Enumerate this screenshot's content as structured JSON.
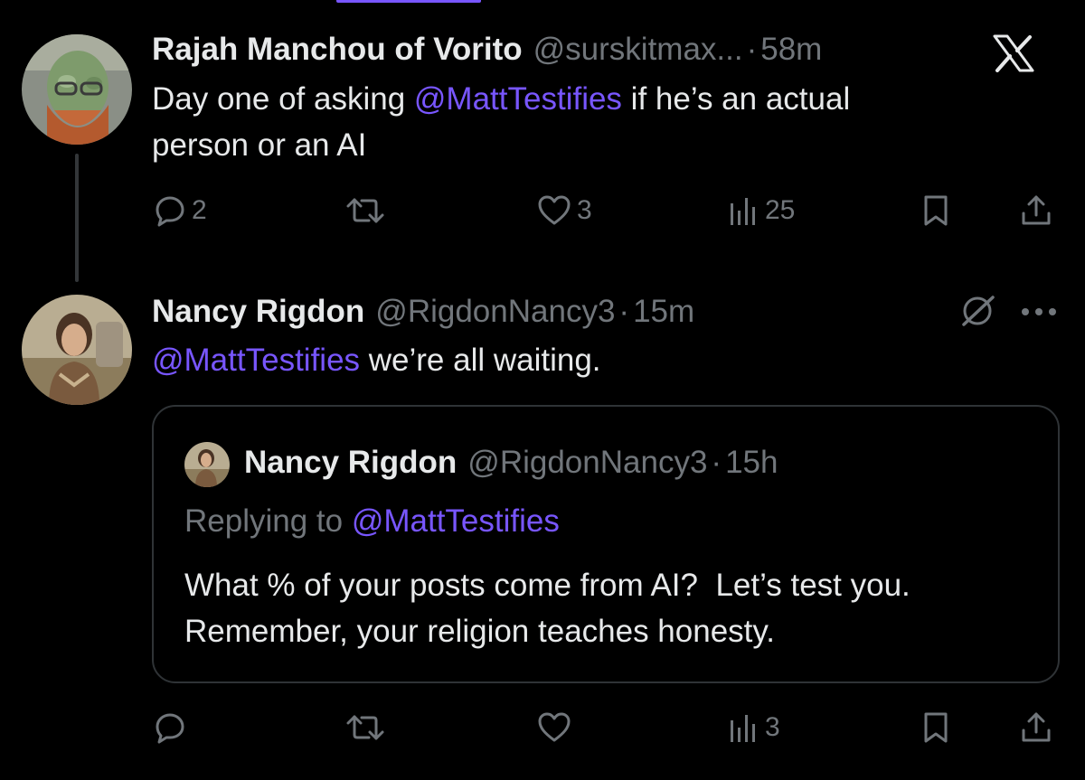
{
  "posts": [
    {
      "name": "Rajah Manchou of Vorito",
      "handle": "@surskitmax...",
      "time": "58m",
      "text_line1_pre": "Day one of asking ",
      "text_line1_mention": "@MattTestifies",
      "text_line1_post": " if he’s an actual",
      "text_line2": "person or an AI",
      "replies": "2",
      "likes": "3",
      "views": "25"
    },
    {
      "name": "Nancy Rigdon",
      "handle": "@RigdonNancy3",
      "time": "15m",
      "text_mention": "@MattTestifies",
      "text_post": " we’re all waiting.",
      "views": "3",
      "quote": {
        "name": "Nancy Rigdon",
        "handle": "@RigdonNancy3",
        "time": "15h",
        "replying_prefix": "Replying to ",
        "replying_mention": "@MattTestifies",
        "text_line1": "What % of your posts come from AI?  Let’s test you.",
        "text_line2": "Remember, your religion teaches honesty."
      }
    }
  ],
  "separator": "·",
  "colors": {
    "background": "#000000",
    "text": "#e7e9ea",
    "secondary": "#71767b",
    "accent": "#7856ff",
    "border": "#2f3336"
  },
  "icons": [
    "x-logo-icon",
    "grok-icon",
    "more-icon",
    "reply-icon",
    "repost-icon",
    "like-icon",
    "views-icon",
    "bookmark-icon",
    "share-icon"
  ]
}
